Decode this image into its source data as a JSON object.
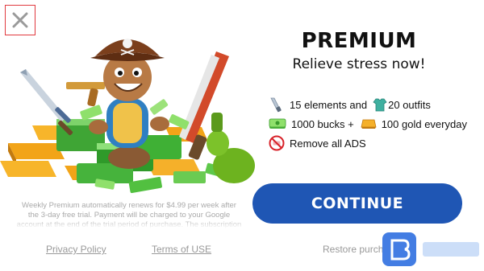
{
  "header": {
    "close_icon": "close-icon"
  },
  "offer": {
    "title": "PREMIUM",
    "subtitle": "Relieve stress now!",
    "features": [
      {
        "icon": "knife-icon",
        "text": "15 elements and",
        "icon2": "outfit-icon",
        "text2": "20 outfits"
      },
      {
        "icon": "cash-icon",
        "text": "1000 bucks +",
        "icon2": "gold-bar-icon",
        "text2": "100 gold everyday"
      },
      {
        "icon": "no-ads-icon",
        "text": "Remove all ADS"
      }
    ]
  },
  "cta": {
    "label": "CONTINUE"
  },
  "disclaimer": "Weekly Premium automatically renews for $4.99 per week after the 3-day free trial. Payment will be charged to your Google account at the end of the trial period of purchase. The subscription automatically renews",
  "footer": {
    "privacy_label": "Privacy Policy",
    "terms_label": "Terms of USE",
    "restore_label": "Restore purchases"
  },
  "colors": {
    "accent": "#1f56b4",
    "close_border": "#e0393e"
  }
}
